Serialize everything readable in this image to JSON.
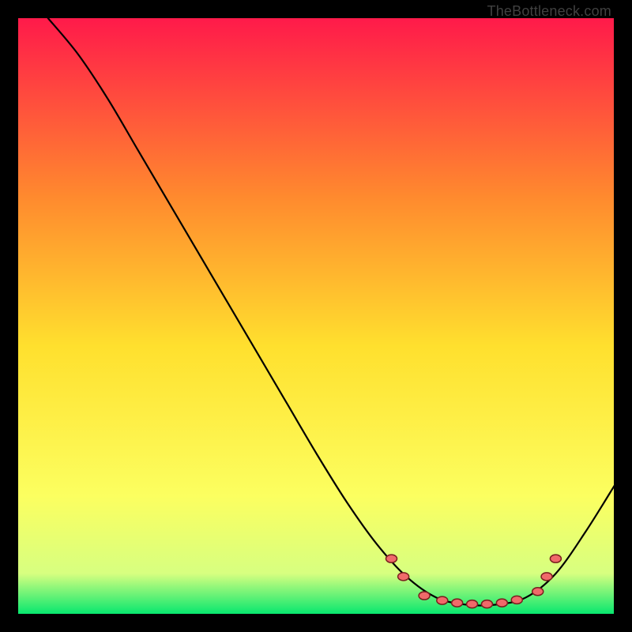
{
  "watermark": "TheBottleneck.com",
  "chart_data": {
    "type": "line",
    "title": "",
    "xlabel": "",
    "ylabel": "",
    "xlim": [
      0,
      100
    ],
    "ylim": [
      0,
      100
    ],
    "background_gradient": {
      "top": "#ff1a4a",
      "mid_upper": "#ff8a2e",
      "mid": "#ffe02e",
      "mid_lower": "#fcff60",
      "near_bottom": "#d7ff80",
      "bottom": "#00e66e"
    },
    "curve": [
      {
        "x": 5.0,
        "y": 100.0
      },
      {
        "x": 10.0,
        "y": 94.0
      },
      {
        "x": 15.0,
        "y": 86.5
      },
      {
        "x": 20.0,
        "y": 78.0
      },
      {
        "x": 25.0,
        "y": 69.5
      },
      {
        "x": 30.0,
        "y": 61.0
      },
      {
        "x": 35.0,
        "y": 52.5
      },
      {
        "x": 40.0,
        "y": 44.0
      },
      {
        "x": 45.0,
        "y": 35.5
      },
      {
        "x": 50.0,
        "y": 27.0
      },
      {
        "x": 55.0,
        "y": 19.0
      },
      {
        "x": 60.0,
        "y": 12.0
      },
      {
        "x": 65.0,
        "y": 6.5
      },
      {
        "x": 70.0,
        "y": 3.0
      },
      {
        "x": 75.0,
        "y": 1.8
      },
      {
        "x": 80.0,
        "y": 1.8
      },
      {
        "x": 85.0,
        "y": 3.0
      },
      {
        "x": 90.0,
        "y": 7.0
      },
      {
        "x": 95.0,
        "y": 14.0
      },
      {
        "x": 100.0,
        "y": 22.0
      }
    ],
    "markers": [
      {
        "x": 62.5,
        "y": 9.5
      },
      {
        "x": 64.5,
        "y": 6.5
      },
      {
        "x": 68.0,
        "y": 3.3
      },
      {
        "x": 71.0,
        "y": 2.5
      },
      {
        "x": 73.5,
        "y": 2.1
      },
      {
        "x": 76.0,
        "y": 1.9
      },
      {
        "x": 78.5,
        "y": 1.9
      },
      {
        "x": 81.0,
        "y": 2.1
      },
      {
        "x": 83.5,
        "y": 2.6
      },
      {
        "x": 87.0,
        "y": 4.0
      },
      {
        "x": 88.5,
        "y": 6.5
      },
      {
        "x": 90.0,
        "y": 9.5
      }
    ],
    "marker_style": {
      "fill": "#f06a6a",
      "stroke": "#7a1e1e",
      "rx": 7,
      "ry": 5
    }
  }
}
